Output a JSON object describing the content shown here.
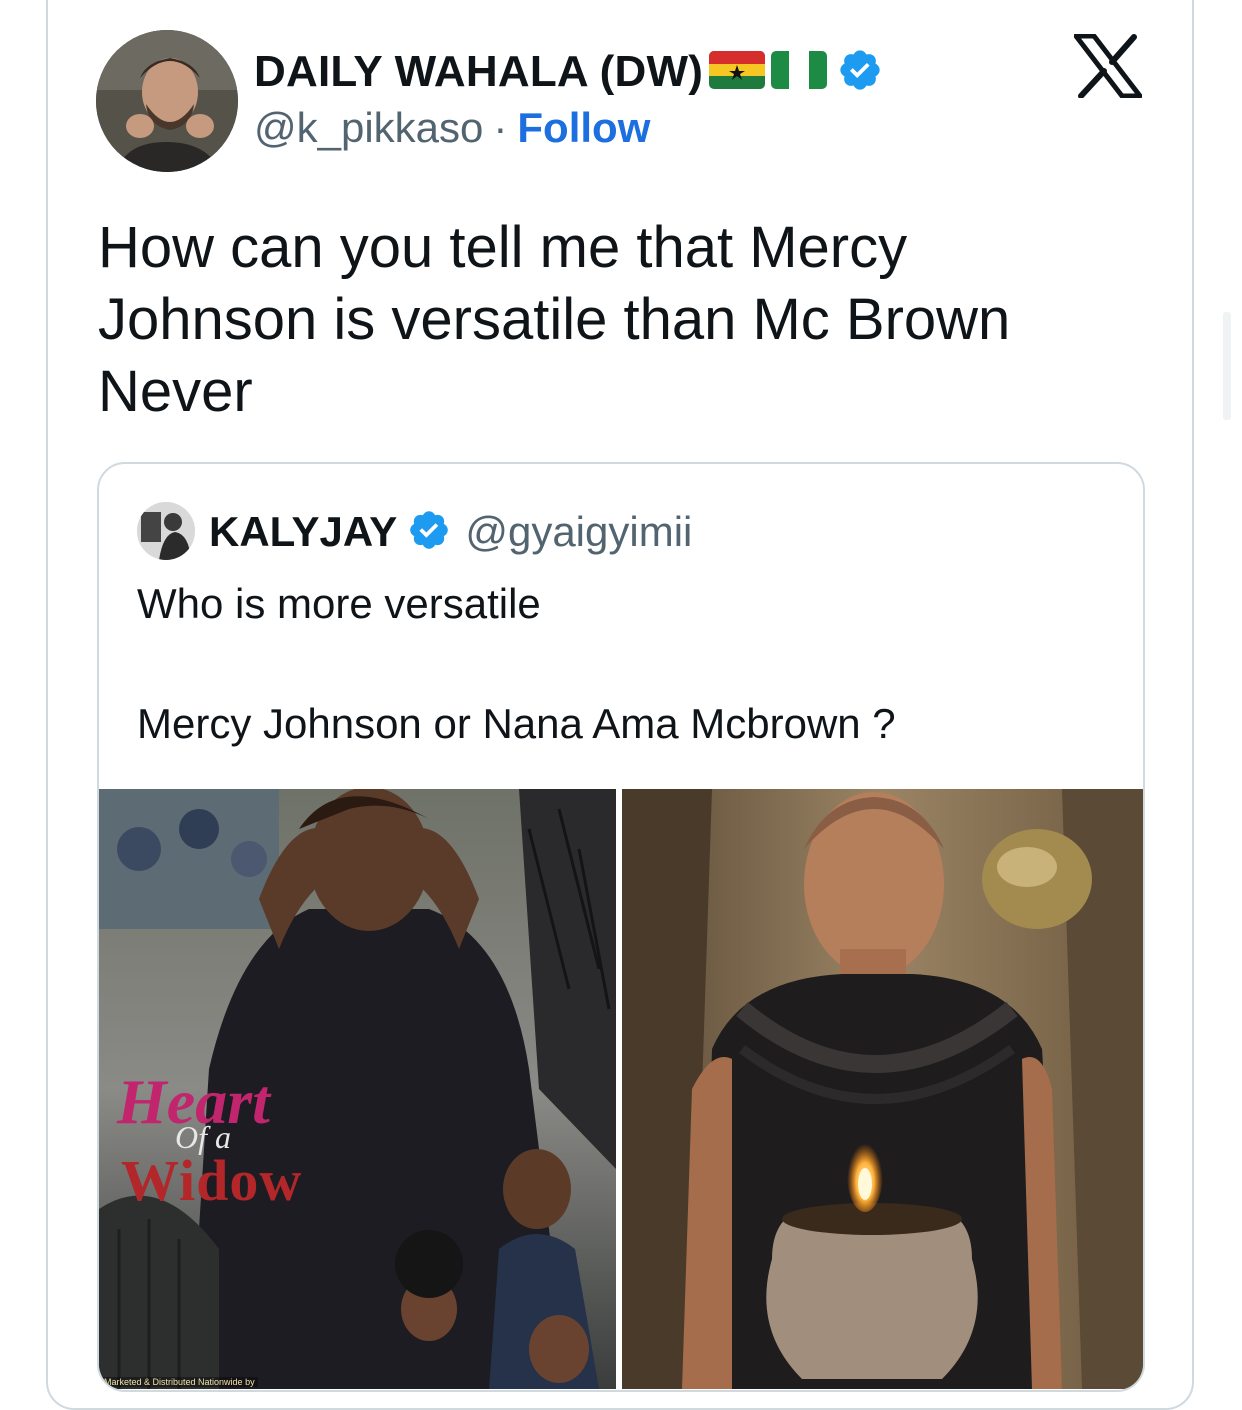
{
  "tweet": {
    "author": {
      "display_name": "DAILY WAHALA (DW)",
      "handle": "@k_pikkaso",
      "separator": "·",
      "follow_label": "Follow",
      "flags": [
        "ghana-flag",
        "nigeria-flag"
      ],
      "verified": true
    },
    "brand_icon": "x-logo-icon",
    "text_lines": [
      "How can you tell me that Mercy",
      "Johnson is versatile than Mc Brown",
      "Never"
    ]
  },
  "quote": {
    "author": {
      "display_name": "KALYJAY",
      "handle": "@gyaigyimii",
      "verified": true
    },
    "text_line_1": "Who is more versatile",
    "text_line_2": "Mercy Johnson or Nana Ama Mcbrown ?",
    "media": {
      "left": {
        "poster_heart": "Heart",
        "poster_of": "Of a",
        "poster_widow": "Widow",
        "credit": "Marketed & Distributed Nationwide by"
      },
      "right": {}
    }
  },
  "colors": {
    "link": "#1d6fe0",
    "verified": "#1d9bf0",
    "border": "#cfd9de",
    "secondary_text": "#536471"
  }
}
